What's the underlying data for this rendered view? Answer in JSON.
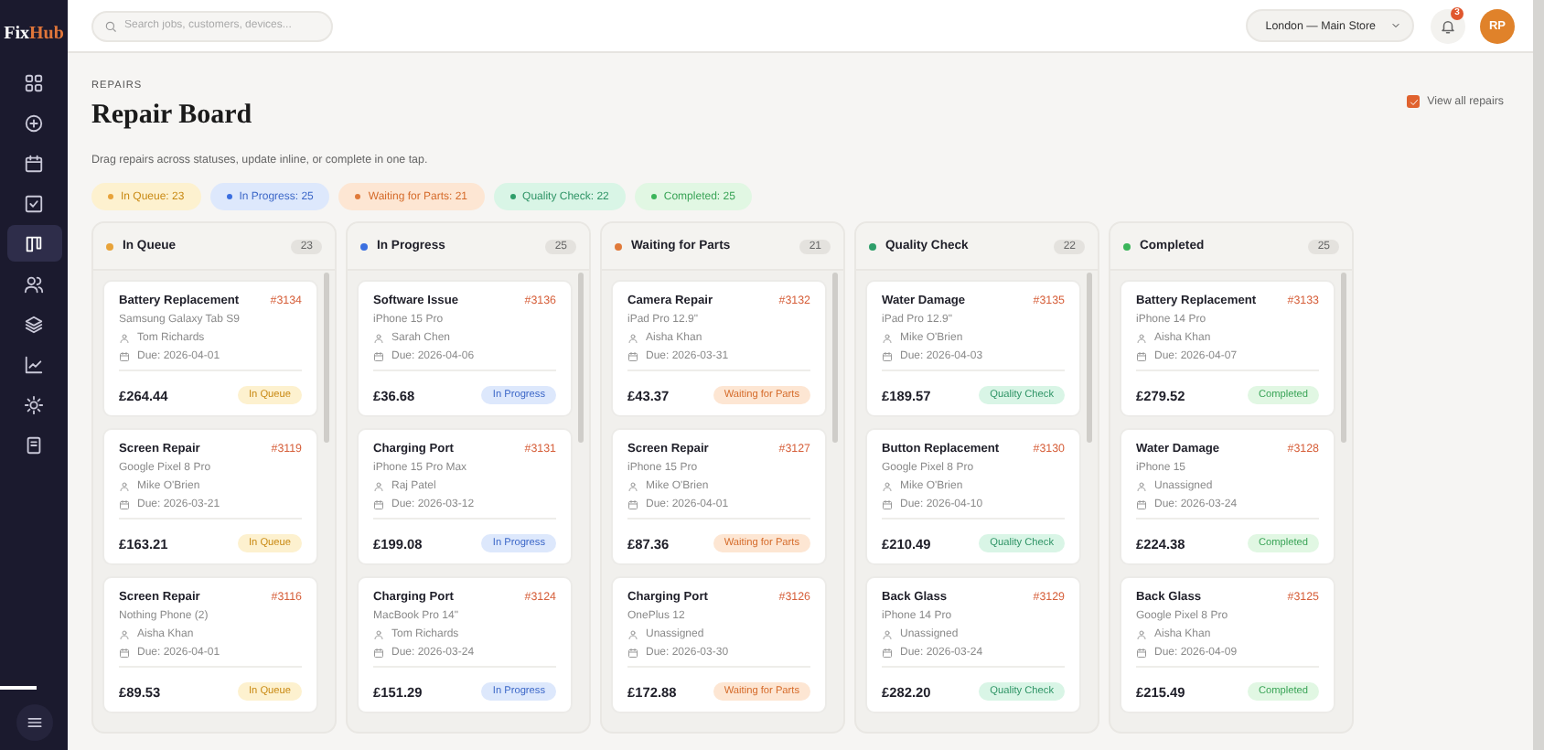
{
  "sidebar": {
    "logo": [
      "Fix",
      "Hub"
    ],
    "items": [
      {
        "kind": "grid",
        "selected": false
      },
      {
        "kind": "plus",
        "selected": false
      },
      {
        "kind": "calendar",
        "selected": false
      },
      {
        "kind": "check",
        "selected": false
      },
      {
        "kind": "board",
        "selected": true
      },
      {
        "kind": "users",
        "selected": false
      },
      {
        "kind": "layers",
        "selected": false
      },
      {
        "kind": "chart",
        "selected": false
      },
      {
        "kind": "sun",
        "selected": false
      },
      {
        "kind": "document",
        "selected": false
      }
    ]
  },
  "topbar": {
    "search": {
      "placeholder": "Search jobs, customers, devices..."
    },
    "store": "London — Main Store",
    "notifications": "3",
    "avatar": "RP"
  },
  "page": {
    "eyebrow": "REPAIRS",
    "title": "Repair Board",
    "subtitle": "Drag repairs across statuses, update inline, or complete in one tap.",
    "view_all": {
      "label": "View all repairs",
      "checked": true
    }
  },
  "summary": [
    {
      "label": "In Queue: 23",
      "kind": "queue"
    },
    {
      "label": "In Progress: 25",
      "kind": "progress"
    },
    {
      "label": "Waiting for Parts: 21",
      "kind": "parts"
    },
    {
      "label": "Quality Check: 22",
      "kind": "qc"
    },
    {
      "label": "Completed: 25",
      "kind": "done"
    }
  ],
  "columns": [
    {
      "title": "In Queue",
      "count": "23",
      "kind": "queue",
      "cards": [
        {
          "title": "Battery Replacement",
          "number": "#3134",
          "device": "Samsung Galaxy Tab S9",
          "assignee": "Tom Richards",
          "due": "Due: 2026-04-01",
          "price": "£264.44",
          "status": "In Queue"
        },
        {
          "title": "Screen Repair",
          "number": "#3119",
          "device": "Google Pixel 8 Pro",
          "assignee": "Mike O'Brien",
          "due": "Due: 2026-03-21",
          "price": "£163.21",
          "status": "In Queue"
        },
        {
          "title": "Screen Repair",
          "number": "#3116",
          "device": "Nothing Phone (2)",
          "assignee": "Aisha Khan",
          "due": "Due: 2026-04-01",
          "price": "£89.53",
          "status": "In Queue"
        }
      ]
    },
    {
      "title": "In Progress",
      "count": "25",
      "kind": "progress",
      "cards": [
        {
          "title": "Software Issue",
          "number": "#3136",
          "device": "iPhone 15 Pro",
          "assignee": "Sarah Chen",
          "due": "Due: 2026-04-06",
          "price": "£36.68",
          "status": "In Progress"
        },
        {
          "title": "Charging Port",
          "number": "#3131",
          "device": "iPhone 15 Pro Max",
          "assignee": "Raj Patel",
          "due": "Due: 2026-03-12",
          "price": "£199.08",
          "status": "In Progress"
        },
        {
          "title": "Charging Port",
          "number": "#3124",
          "device": "MacBook Pro 14\"",
          "assignee": "Tom Richards",
          "due": "Due: 2026-03-24",
          "price": "£151.29",
          "status": "In Progress"
        }
      ]
    },
    {
      "title": "Waiting for Parts",
      "count": "21",
      "kind": "parts",
      "cards": [
        {
          "title": "Camera Repair",
          "number": "#3132",
          "device": "iPad Pro 12.9\"",
          "assignee": "Aisha Khan",
          "due": "Due: 2026-03-31",
          "price": "£43.37",
          "status": "Waiting for Parts"
        },
        {
          "title": "Screen Repair",
          "number": "#3127",
          "device": "iPhone 15 Pro",
          "assignee": "Mike O'Brien",
          "due": "Due: 2026-04-01",
          "price": "£87.36",
          "status": "Waiting for Parts"
        },
        {
          "title": "Charging Port",
          "number": "#3126",
          "device": "OnePlus 12",
          "assignee": "Unassigned",
          "due": "Due: 2026-03-30",
          "price": "£172.88",
          "status": "Waiting for Parts"
        }
      ]
    },
    {
      "title": "Quality Check",
      "count": "22",
      "kind": "qc",
      "cards": [
        {
          "title": "Water Damage",
          "number": "#3135",
          "device": "iPad Pro 12.9\"",
          "assignee": "Mike O'Brien",
          "due": "Due: 2026-04-03",
          "price": "£189.57",
          "status": "Quality Check"
        },
        {
          "title": "Button Replacement",
          "number": "#3130",
          "device": "Google Pixel 8 Pro",
          "assignee": "Mike O'Brien",
          "due": "Due: 2026-04-10",
          "price": "£210.49",
          "status": "Quality Check"
        },
        {
          "title": "Back Glass",
          "number": "#3129",
          "device": "iPhone 14 Pro",
          "assignee": "Unassigned",
          "due": "Due: 2026-03-24",
          "price": "£282.20",
          "status": "Quality Check"
        }
      ]
    },
    {
      "title": "Completed",
      "count": "25",
      "kind": "done",
      "cards": [
        {
          "title": "Battery Replacement",
          "number": "#3133",
          "device": "iPhone 14 Pro",
          "assignee": "Aisha Khan",
          "due": "Due: 2026-04-07",
          "price": "£279.52",
          "status": "Completed"
        },
        {
          "title": "Water Damage",
          "number": "#3128",
          "device": "iPhone 15",
          "assignee": "Unassigned",
          "due": "Due: 2026-03-24",
          "price": "£224.38",
          "status": "Completed"
        },
        {
          "title": "Back Glass",
          "number": "#3125",
          "device": "Google Pixel 8 Pro",
          "assignee": "Aisha Khan",
          "due": "Due: 2026-04-09",
          "price": "£215.49",
          "status": "Completed"
        }
      ]
    }
  ]
}
